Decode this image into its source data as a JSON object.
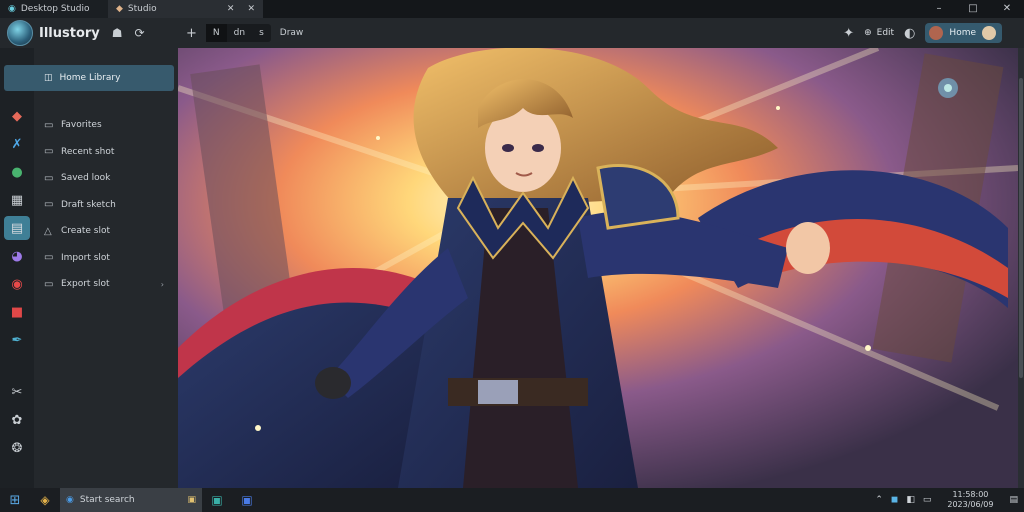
{
  "titlebar": {
    "tabs": [
      {
        "label": "Desktop Studio",
        "icon": "app-logo-icon"
      },
      {
        "label": "Studio",
        "icon": "studio-tab-icon"
      }
    ],
    "controls": {
      "minimize": "–",
      "maximize": "□",
      "close": "✕",
      "tab_close": "✕",
      "tab_close2": "✕"
    }
  },
  "toolbar": {
    "brand": "Illustory",
    "new_tab": "+",
    "segment": [
      "N",
      "dn",
      "s"
    ],
    "label": "Draw",
    "right_labels": {
      "ai": "Edit",
      "profile": "Home"
    }
  },
  "sidebar": {
    "header": "Home Library",
    "items": [
      {
        "label": "Favorites"
      },
      {
        "label": "Recent shot"
      },
      {
        "label": "Saved look"
      },
      {
        "label": "Draft sketch"
      },
      {
        "label": "Create slot"
      },
      {
        "label": "Import slot"
      },
      {
        "label": "Export slot"
      }
    ]
  },
  "taskbar": {
    "search_placeholder": "Start search",
    "time": "11:58:00",
    "date": "2023/06/09"
  },
  "colors": {
    "accent": "#3f7f96",
    "panel": "#24282c",
    "rail": "#1d2125"
  }
}
